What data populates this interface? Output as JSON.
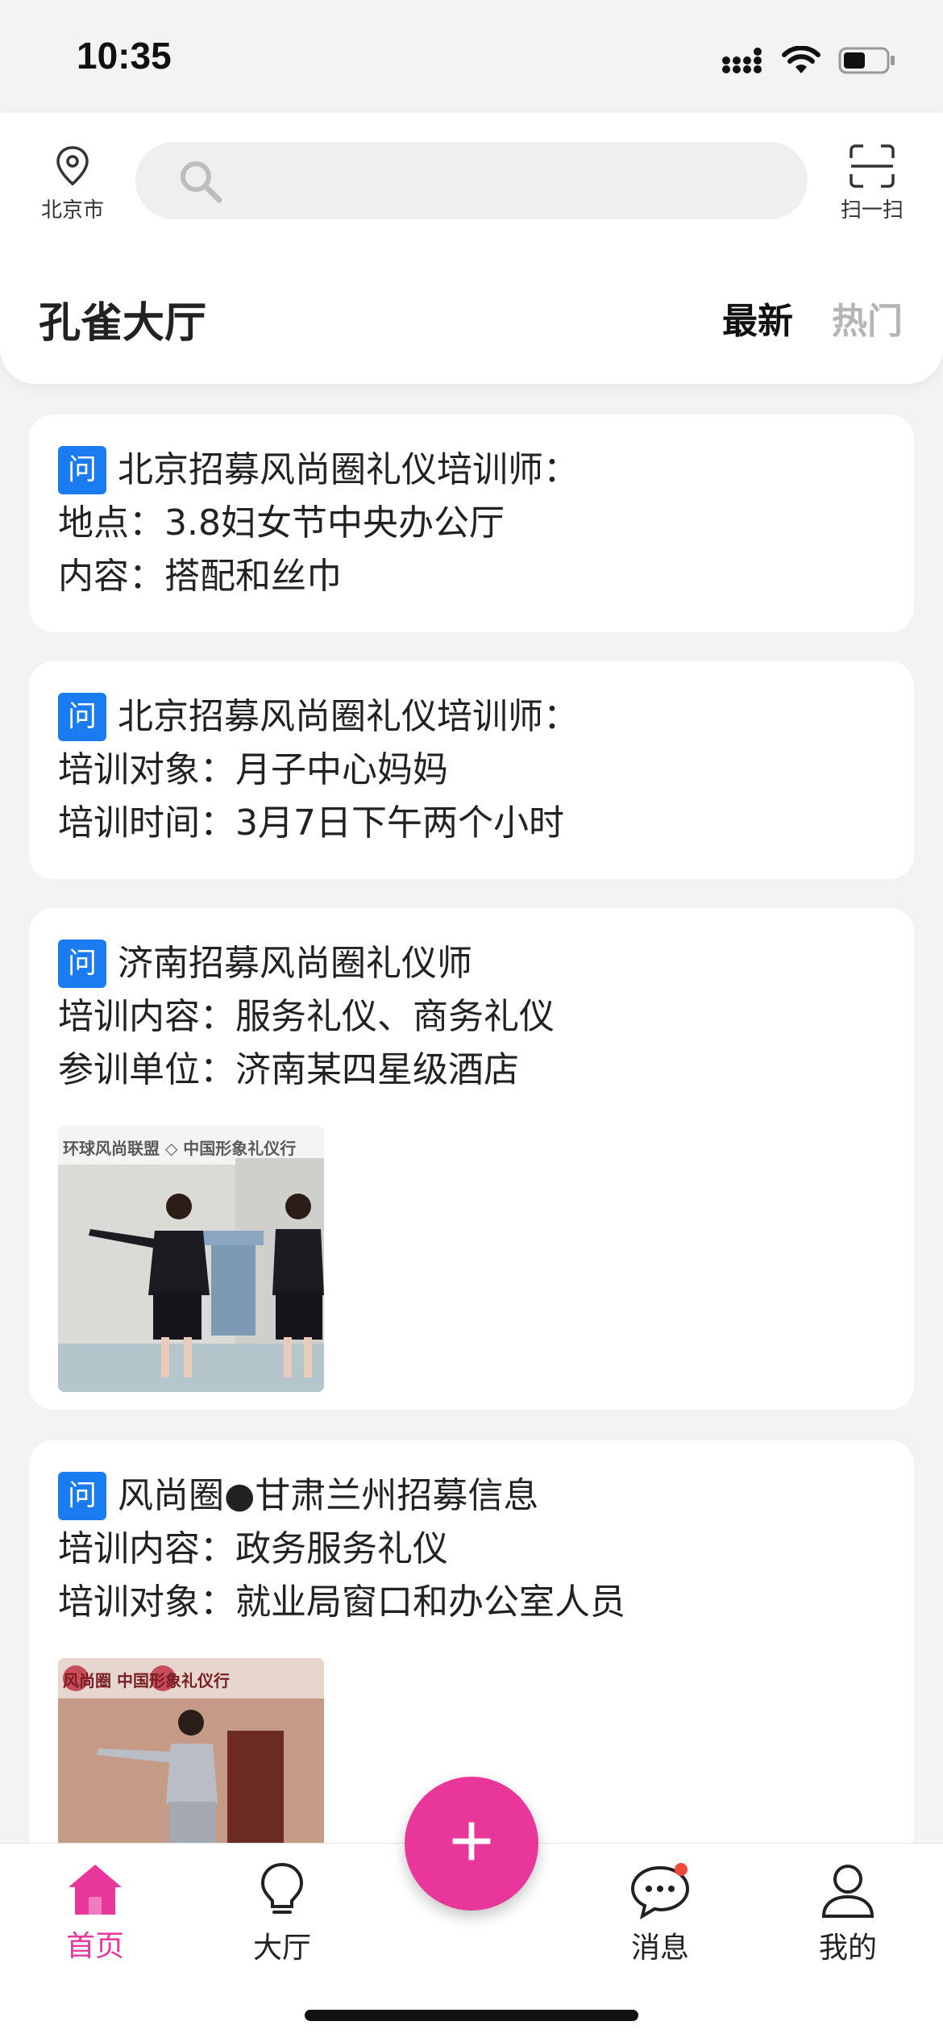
{
  "status_bar": {
    "time": "10:35"
  },
  "header": {
    "location_label": "北京市",
    "search_placeholder": "",
    "scan_label": "扫一扫",
    "title": "孔雀大厅",
    "sort_tabs": [
      {
        "label": "最新",
        "active": true
      },
      {
        "label": "热门",
        "active": false
      }
    ]
  },
  "badge_label": "问",
  "posts": [
    {
      "title": "北京招募风尚圈礼仪培训师：",
      "lines": [
        "地点：3.8妇女节中央办公厅",
        "内容：搭配和丝巾"
      ]
    },
    {
      "title": "北京招募风尚圈礼仪培训师：",
      "lines": [
        "培训对象：月子中心妈妈",
        "培训时间：3月7日下午两个小时"
      ]
    },
    {
      "title": "济南招募风尚圈礼仪师",
      "lines": [
        "培训内容：服务礼仪、商务礼仪",
        "参训单位：济南某四星级酒店"
      ],
      "image_banner": "环球风尚联盟 ◇ 中国形象礼仪行"
    },
    {
      "title": "风尚圈●甘肃兰州招募信息",
      "lines": [
        "培训内容：政务服务礼仪",
        "培训对象：就业局窗口和办公室人员"
      ],
      "image_banner": "风尚圈  中国形象礼仪行"
    }
  ],
  "tab_bar": {
    "items": [
      {
        "label": "首页",
        "icon": "home-icon",
        "active": true
      },
      {
        "label": "大厅",
        "icon": "lightbulb-icon",
        "active": false
      },
      {
        "label": "消息",
        "icon": "chat-icon",
        "active": false,
        "has_badge": true
      },
      {
        "label": "我的",
        "icon": "user-icon",
        "active": false
      }
    ],
    "fab_label": "+"
  },
  "colors": {
    "accent": "#e8369a",
    "badge_blue": "#1a7cf0",
    "notify_red": "#f0493a"
  }
}
